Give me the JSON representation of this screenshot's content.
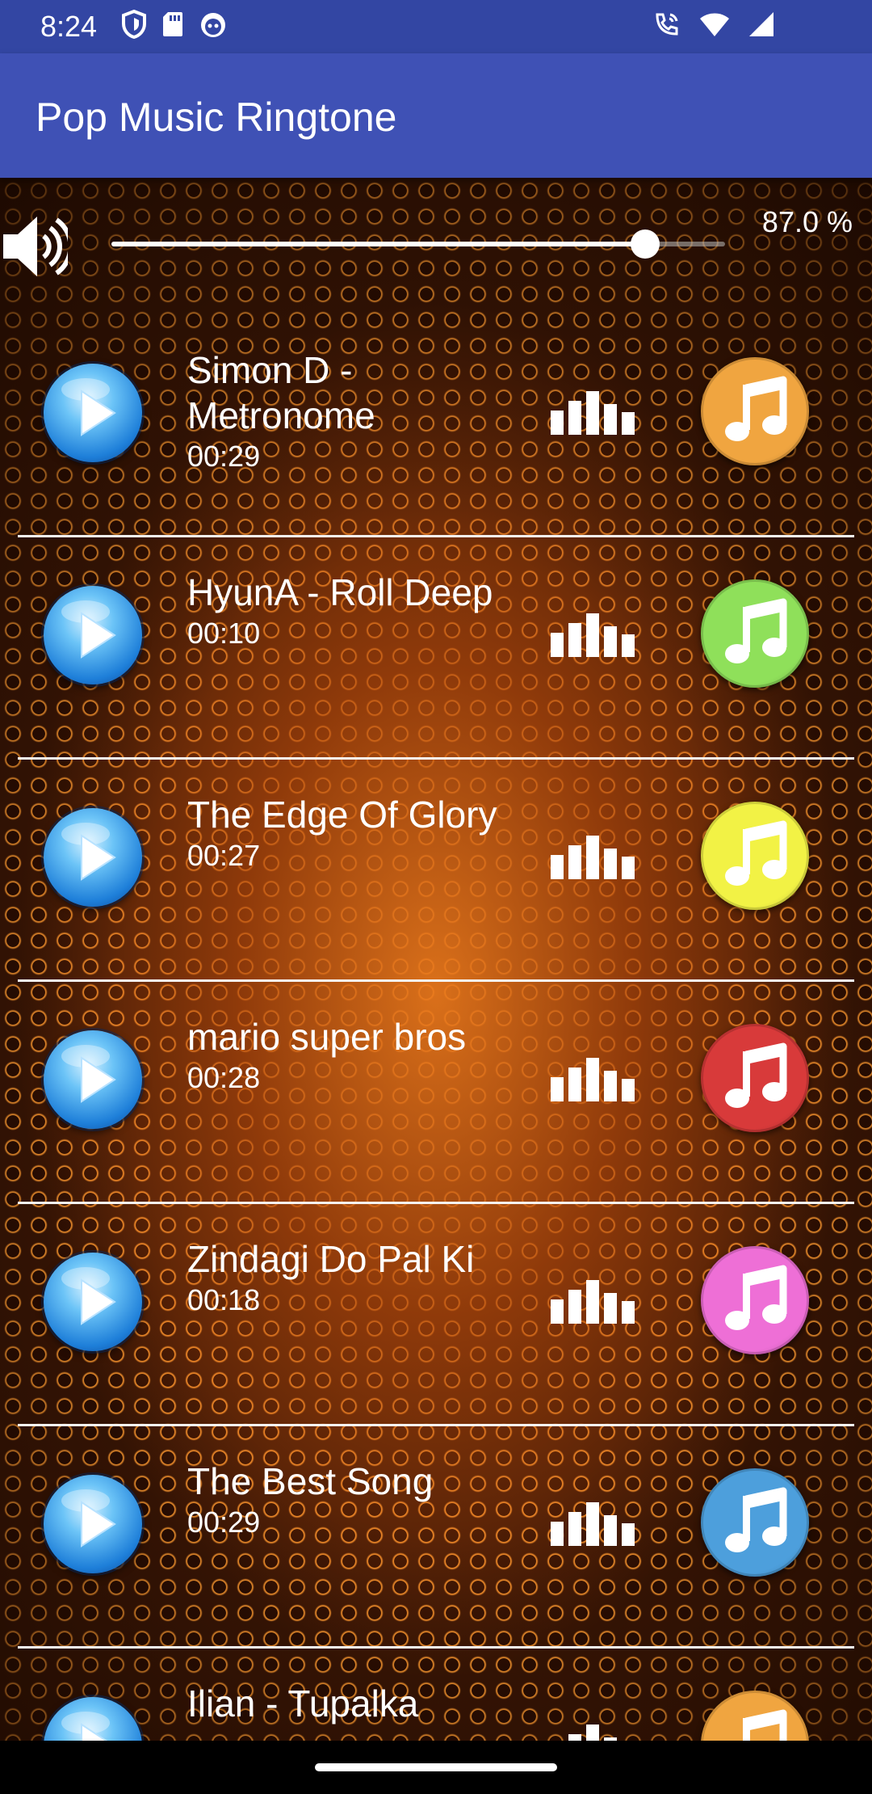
{
  "status_bar": {
    "time": "8:24"
  },
  "app_bar": {
    "title": "Pop Music Ringtone"
  },
  "volume": {
    "percent_label": "87.0 %",
    "level": 0.87
  },
  "songs": [
    {
      "title": "Simon D - Metronome",
      "duration": "00:29",
      "color": "#f0a540"
    },
    {
      "title": "HyunA - Roll Deep",
      "duration": "00:10",
      "color": "#8fe05a"
    },
    {
      "title": "The Edge Of Glory",
      "duration": "00:27",
      "color": "#f2f245"
    },
    {
      "title": "mario super bros",
      "duration": "00:28",
      "color": "#d83a3a"
    },
    {
      "title": "Zindagi Do Pal Ki",
      "duration": "00:18",
      "color": "#ee6fd6"
    },
    {
      "title": "The Best Song",
      "duration": "00:29",
      "color": "#4d9fdc"
    },
    {
      "title": "Ilian - Tupalka",
      "duration": "",
      "color": "#f0a540"
    }
  ],
  "icons": {
    "status": [
      "shield-icon",
      "sd-card-icon",
      "face-icon",
      "wifi-call-icon",
      "wifi-icon",
      "signal-icon"
    ],
    "row": [
      "play-icon",
      "equalizer-icon",
      "music-note-icon"
    ],
    "volume": "speaker-icon"
  }
}
